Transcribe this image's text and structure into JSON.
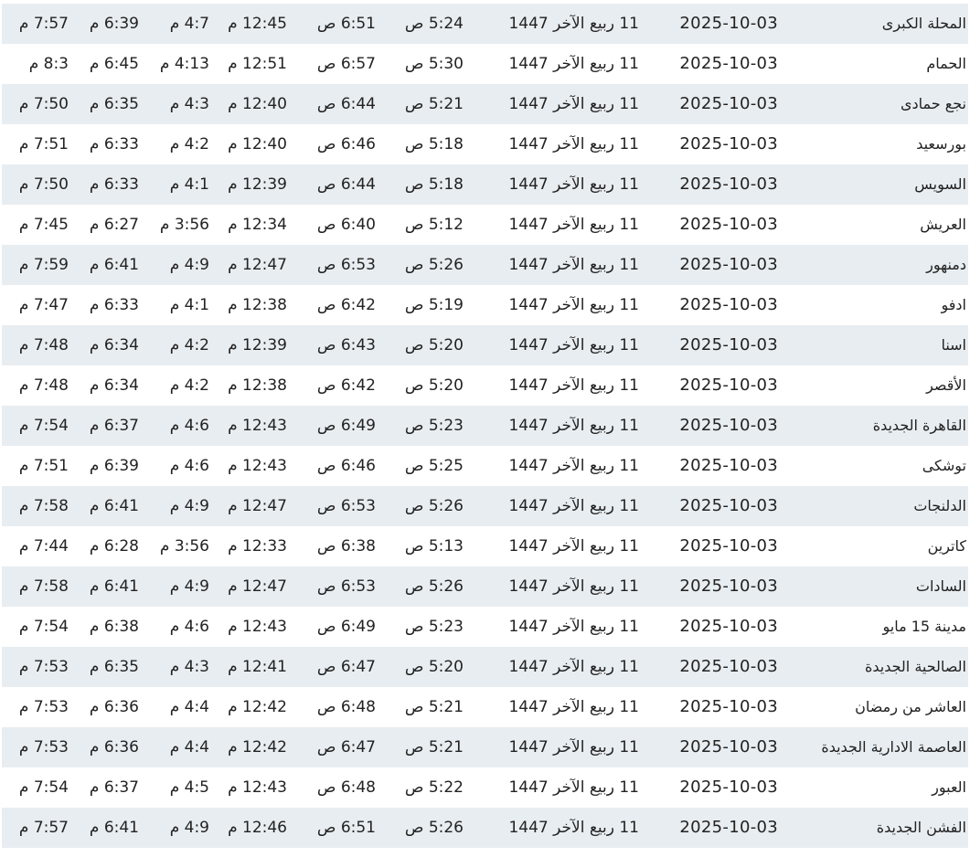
{
  "rows": [
    {
      "city": "المحلة الكبرى",
      "date": "2025-10-03",
      "hijri": "11 ربيع الآخر 1447",
      "fajr": "5:24 ص",
      "sunrise": "6:51 ص",
      "dhuhr": "12:45 م",
      "asr": "4:7 م",
      "maghrib": "6:39 م",
      "isha": "7:57 م"
    },
    {
      "city": "الحمام",
      "date": "2025-10-03",
      "hijri": "11 ربيع الآخر 1447",
      "fajr": "5:30 ص",
      "sunrise": "6:57 ص",
      "dhuhr": "12:51 م",
      "asr": "4:13 م",
      "maghrib": "6:45 م",
      "isha": "8:3 م"
    },
    {
      "city": "نجع حمادى",
      "date": "2025-10-03",
      "hijri": "11 ربيع الآخر 1447",
      "fajr": "5:21 ص",
      "sunrise": "6:44 ص",
      "dhuhr": "12:40 م",
      "asr": "4:3 م",
      "maghrib": "6:35 م",
      "isha": "7:50 م"
    },
    {
      "city": "بورسعيد",
      "date": "2025-10-03",
      "hijri": "11 ربيع الآخر 1447",
      "fajr": "5:18 ص",
      "sunrise": "6:46 ص",
      "dhuhr": "12:40 م",
      "asr": "4:2 م",
      "maghrib": "6:33 م",
      "isha": "7:51 م"
    },
    {
      "city": "السويس",
      "date": "2025-10-03",
      "hijri": "11 ربيع الآخر 1447",
      "fajr": "5:18 ص",
      "sunrise": "6:44 ص",
      "dhuhr": "12:39 م",
      "asr": "4:1 م",
      "maghrib": "6:33 م",
      "isha": "7:50 م"
    },
    {
      "city": "العريش",
      "date": "2025-10-03",
      "hijri": "11 ربيع الآخر 1447",
      "fajr": "5:12 ص",
      "sunrise": "6:40 ص",
      "dhuhr": "12:34 م",
      "asr": "3:56 م",
      "maghrib": "6:27 م",
      "isha": "7:45 م"
    },
    {
      "city": "دمنهور",
      "date": "2025-10-03",
      "hijri": "11 ربيع الآخر 1447",
      "fajr": "5:26 ص",
      "sunrise": "6:53 ص",
      "dhuhr": "12:47 م",
      "asr": "4:9 م",
      "maghrib": "6:41 م",
      "isha": "7:59 م"
    },
    {
      "city": "ادفو",
      "date": "2025-10-03",
      "hijri": "11 ربيع الآخر 1447",
      "fajr": "5:19 ص",
      "sunrise": "6:42 ص",
      "dhuhr": "12:38 م",
      "asr": "4:1 م",
      "maghrib": "6:33 م",
      "isha": "7:47 م"
    },
    {
      "city": "اسنا",
      "date": "2025-10-03",
      "hijri": "11 ربيع الآخر 1447",
      "fajr": "5:20 ص",
      "sunrise": "6:43 ص",
      "dhuhr": "12:39 م",
      "asr": "4:2 م",
      "maghrib": "6:34 م",
      "isha": "7:48 م"
    },
    {
      "city": "الأقصر",
      "date": "2025-10-03",
      "hijri": "11 ربيع الآخر 1447",
      "fajr": "5:20 ص",
      "sunrise": "6:42 ص",
      "dhuhr": "12:38 م",
      "asr": "4:2 م",
      "maghrib": "6:34 م",
      "isha": "7:48 م"
    },
    {
      "city": "القاهرة الجديدة",
      "date": "2025-10-03",
      "hijri": "11 ربيع الآخر 1447",
      "fajr": "5:23 ص",
      "sunrise": "6:49 ص",
      "dhuhr": "12:43 م",
      "asr": "4:6 م",
      "maghrib": "6:37 م",
      "isha": "7:54 م"
    },
    {
      "city": "توشكى",
      "date": "2025-10-03",
      "hijri": "11 ربيع الآخر 1447",
      "fajr": "5:25 ص",
      "sunrise": "6:46 ص",
      "dhuhr": "12:43 م",
      "asr": "4:6 م",
      "maghrib": "6:39 م",
      "isha": "7:51 م"
    },
    {
      "city": "الدلنجات",
      "date": "2025-10-03",
      "hijri": "11 ربيع الآخر 1447",
      "fajr": "5:26 ص",
      "sunrise": "6:53 ص",
      "dhuhr": "12:47 م",
      "asr": "4:9 م",
      "maghrib": "6:41 م",
      "isha": "7:58 م"
    },
    {
      "city": "كاترين",
      "date": "2025-10-03",
      "hijri": "11 ربيع الآخر 1447",
      "fajr": "5:13 ص",
      "sunrise": "6:38 ص",
      "dhuhr": "12:33 م",
      "asr": "3:56 م",
      "maghrib": "6:28 م",
      "isha": "7:44 م"
    },
    {
      "city": "السادات",
      "date": "2025-10-03",
      "hijri": "11 ربيع الآخر 1447",
      "fajr": "5:26 ص",
      "sunrise": "6:53 ص",
      "dhuhr": "12:47 م",
      "asr": "4:9 م",
      "maghrib": "6:41 م",
      "isha": "7:58 م"
    },
    {
      "city": "مدينة 15 مايو",
      "date": "2025-10-03",
      "hijri": "11 ربيع الآخر 1447",
      "fajr": "5:23 ص",
      "sunrise": "6:49 ص",
      "dhuhr": "12:43 م",
      "asr": "4:6 م",
      "maghrib": "6:38 م",
      "isha": "7:54 م"
    },
    {
      "city": "الصالحية الجديدة",
      "date": "2025-10-03",
      "hijri": "11 ربيع الآخر 1447",
      "fajr": "5:20 ص",
      "sunrise": "6:47 ص",
      "dhuhr": "12:41 م",
      "asr": "4:3 م",
      "maghrib": "6:35 م",
      "isha": "7:53 م"
    },
    {
      "city": "العاشر من رمضان",
      "date": "2025-10-03",
      "hijri": "11 ربيع الآخر 1447",
      "fajr": "5:21 ص",
      "sunrise": "6:48 ص",
      "dhuhr": "12:42 م",
      "asr": "4:4 م",
      "maghrib": "6:36 م",
      "isha": "7:53 م"
    },
    {
      "city": "العاصمة الادارية الجديدة",
      "date": "2025-10-03",
      "hijri": "11 ربيع الآخر 1447",
      "fajr": "5:21 ص",
      "sunrise": "6:47 ص",
      "dhuhr": "12:42 م",
      "asr": "4:4 م",
      "maghrib": "6:36 م",
      "isha": "7:53 م"
    },
    {
      "city": "العبور",
      "date": "2025-10-03",
      "hijri": "11 ربيع الآخر 1447",
      "fajr": "5:22 ص",
      "sunrise": "6:48 ص",
      "dhuhr": "12:43 م",
      "asr": "4:5 م",
      "maghrib": "6:37 م",
      "isha": "7:54 م"
    },
    {
      "city": "الفشن الجديدة",
      "date": "2025-10-03",
      "hijri": "11 ربيع الآخر 1447",
      "fajr": "5:26 ص",
      "sunrise": "6:51 ص",
      "dhuhr": "12:46 م",
      "asr": "4:9 م",
      "maghrib": "6:41 م",
      "isha": "7:57 م"
    }
  ]
}
